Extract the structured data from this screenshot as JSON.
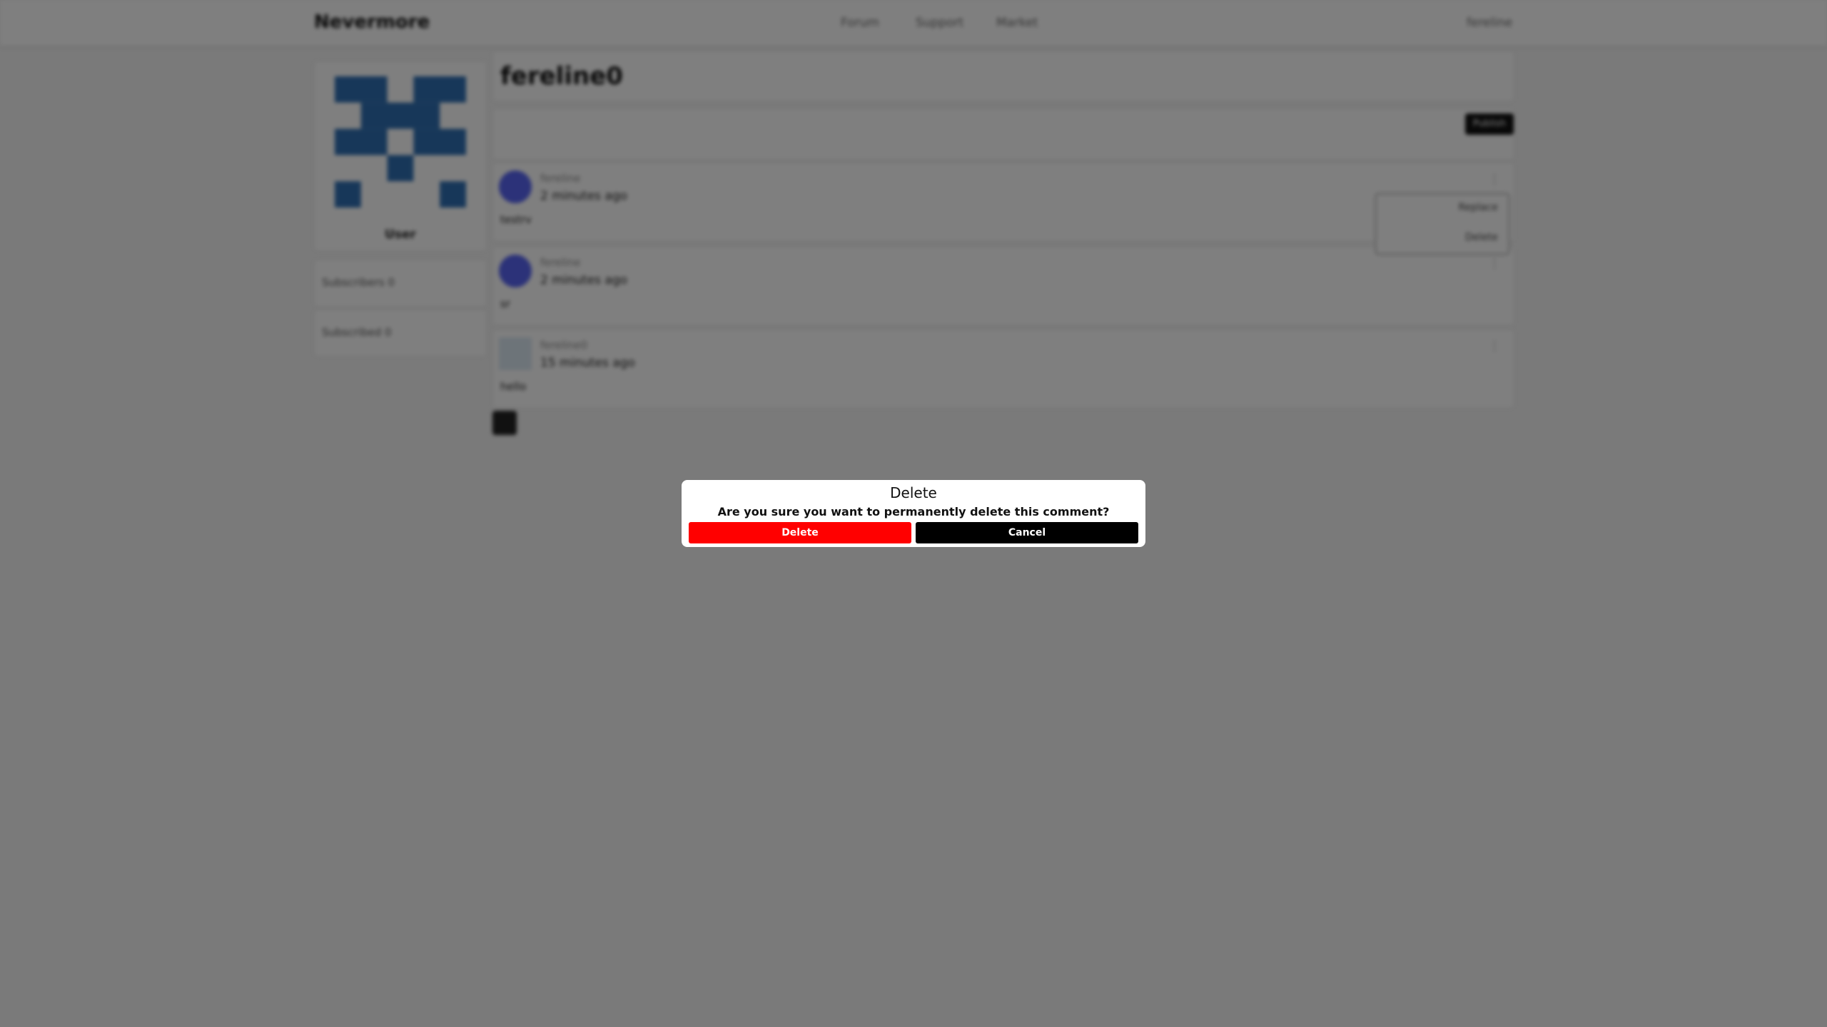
{
  "header": {
    "brand": "Nevermore",
    "nav": [
      "Forum",
      "Support",
      "Market"
    ],
    "user_menu": "fereline"
  },
  "profile": {
    "role": "User",
    "subscribers_label": "Subscribers 0",
    "subscribed_label": "Subscribed 0"
  },
  "page": {
    "title": "fereline0",
    "post_button": "Publish"
  },
  "comments": [
    {
      "author": "fereline",
      "time": "2 minutes ago",
      "body": "testrv"
    },
    {
      "author": "fereline",
      "time": "2 minutes ago",
      "body": "sr"
    },
    {
      "author": "fereline0",
      "time": "15 minutes ago",
      "body": "hello"
    }
  ],
  "comment_menu": [
    "Replace",
    "Delete"
  ],
  "modal": {
    "title": "Delete",
    "message": "Are you sure you want to permanently delete this comment?",
    "confirm_label": "Delete",
    "cancel_label": "Cancel"
  },
  "colors": {
    "danger": "#ff0000",
    "primary": "#000000",
    "overlay": "rgba(0,0,0,0.5)",
    "avatar_accent": "#5865f2",
    "identicon": "#2f6fb3"
  }
}
